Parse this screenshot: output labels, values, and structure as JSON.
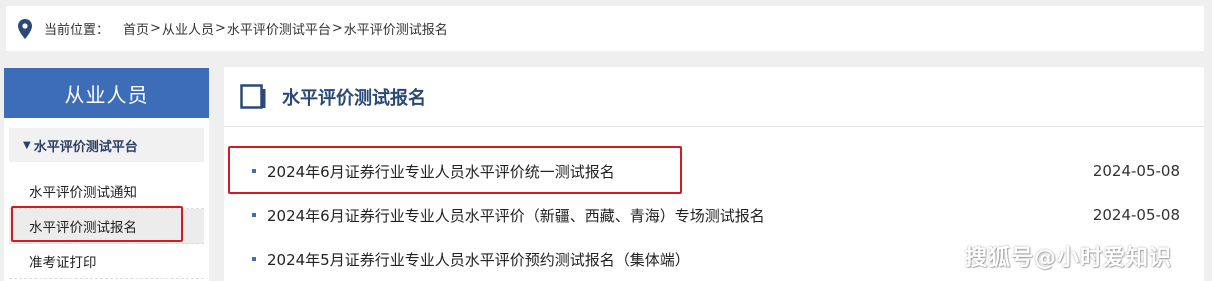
{
  "breadcrumb": {
    "prefix": "当前位置：",
    "items": [
      "首页",
      "从业人员",
      "水平评价测试平台",
      "水平评价测试报名"
    ],
    "separator": ">"
  },
  "sidebar": {
    "header": "从业人员",
    "section_label": "水平评价测试平台",
    "items": [
      {
        "label": "水平评价测试通知"
      },
      {
        "label": "水平评价测试报名"
      },
      {
        "label": "准考证打印"
      }
    ]
  },
  "main": {
    "title": "水平评价测试报名",
    "news": [
      {
        "title": "2024年6月证券行业专业人员水平评价统一测试报名",
        "date": "2024-05-08"
      },
      {
        "title": "2024年6月证券行业专业人员水平评价（新疆、西藏、青海）专场测试报名",
        "date": "2024-05-08"
      },
      {
        "title": "2024年5月证券行业专业人员水平评价预约测试报名（集体端）",
        "date": ""
      }
    ]
  },
  "watermark": "搜狐号@小时爱知识",
  "colors": {
    "accent_blue": "#3d6db8",
    "title_blue": "#2b4978",
    "highlight_red": "#d11c24",
    "background": "#efeff0"
  },
  "icons": {
    "breadcrumb": "location-pin-icon",
    "title": "document-icon",
    "section": "triangle-down-icon"
  }
}
